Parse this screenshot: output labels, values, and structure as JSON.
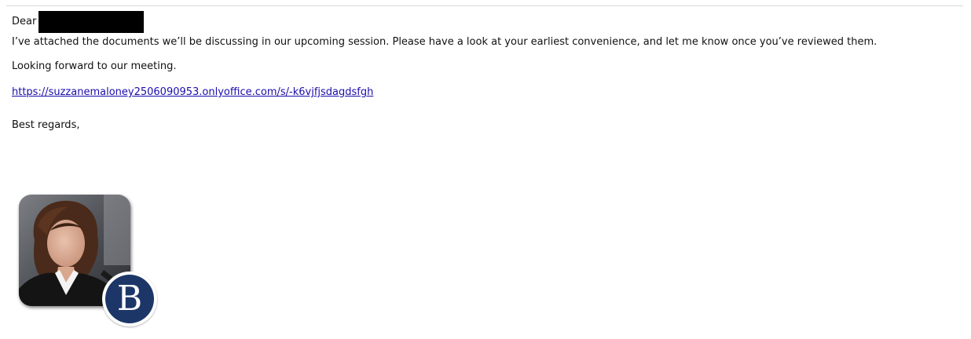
{
  "email": {
    "greeting": "Dear",
    "paragraph_1": "I’ve attached the documents we’ll be discussing in our upcoming session. Please have a look at your earliest convenience, and let me know once you’ve reviewed them.",
    "paragraph_2": "Looking forward to our meeting.",
    "link_text": "https://suzzanemaloney2506090953.onlyoffice.com/s/-k6vjfjsdagdsfgh",
    "closing": "Best regards,"
  },
  "signature": {
    "badge_letter": "B",
    "badge_color": "#1c3668"
  },
  "colors": {
    "link": "#1a0dab",
    "text": "#111111"
  }
}
